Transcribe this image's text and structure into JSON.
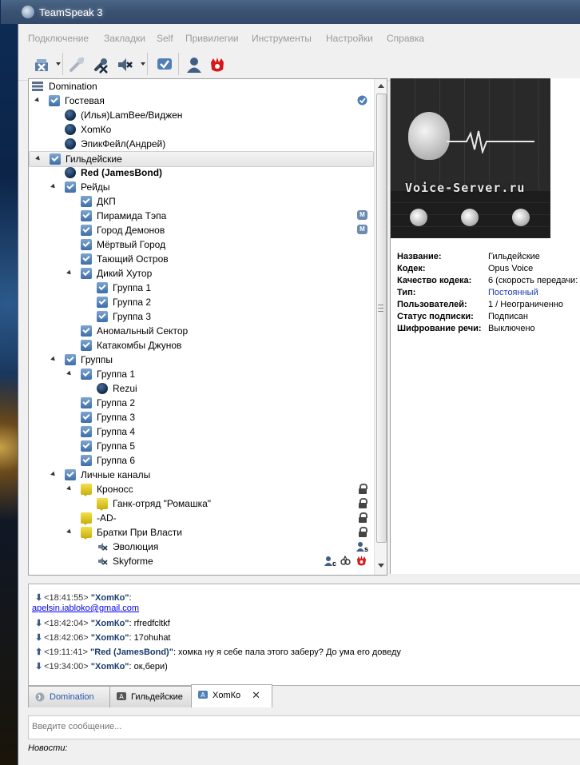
{
  "window": {
    "title": "TeamSpeak 3"
  },
  "menu": [
    "Подключение",
    "Закладки",
    "Self",
    "Привилегии",
    "Инструменты",
    "Настройки",
    "Справка"
  ],
  "toolbar": {
    "icons": [
      "disconnect-icon",
      "away-icon",
      "mute-microphone-icon",
      "mute-speakers-icon",
      "subscribe-icon",
      "contacts-icon",
      "hotkey-icon"
    ]
  },
  "tree": {
    "server": "Domination",
    "rows": [
      {
        "label": "Гостевая",
        "kind": "channel"
      },
      {
        "label": "(Илья)LamBee/Виджен",
        "kind": "client"
      },
      {
        "label": "ХomКо",
        "kind": "client"
      },
      {
        "label": "ЭпикФейл(Андрей)",
        "kind": "client"
      },
      {
        "label": "Гильдейские",
        "kind": "channel"
      },
      {
        "label": "Red (JamesBond)",
        "kind": "client"
      },
      {
        "label": "Рейды",
        "kind": "channel"
      },
      {
        "label": "ДКП",
        "kind": "channel"
      },
      {
        "label": "Пирамида Тэпа",
        "kind": "channel"
      },
      {
        "label": "Город Демонов",
        "kind": "channel"
      },
      {
        "label": "Мёртвый Город",
        "kind": "channel"
      },
      {
        "label": "Тающий Остров",
        "kind": "channel"
      },
      {
        "label": "Дикий Хутор",
        "kind": "channel"
      },
      {
        "label": "Группа 1",
        "kind": "channel"
      },
      {
        "label": "Группа 2",
        "kind": "channel"
      },
      {
        "label": "Группа 3",
        "kind": "channel"
      },
      {
        "label": "Аномальный Сектор",
        "kind": "channel"
      },
      {
        "label": "Катакомбы Джунов",
        "kind": "channel"
      },
      {
        "label": "Группы",
        "kind": "channel"
      },
      {
        "label": "Группа 1",
        "kind": "channel"
      },
      {
        "label": "Rezui",
        "kind": "client"
      },
      {
        "label": "Группа 2",
        "kind": "channel"
      },
      {
        "label": "Группа 3",
        "kind": "channel"
      },
      {
        "label": "Группа 4",
        "kind": "channel"
      },
      {
        "label": "Группа 5",
        "kind": "channel"
      },
      {
        "label": "Группа 6",
        "kind": "channel"
      },
      {
        "label": "Личные каналы",
        "kind": "channel"
      },
      {
        "label": "Кроносс",
        "kind": "channel-yellow"
      },
      {
        "label": "Ганк-отряд \"Ромашка\"",
        "kind": "channel-yellow"
      },
      {
        "label": "-AD-",
        "kind": "channel-yellow"
      },
      {
        "label": "Братки При Власти",
        "kind": "channel-yellow"
      },
      {
        "label": "Эволюция",
        "kind": "client-muted"
      },
      {
        "label": "Skyforme",
        "kind": "client-muted"
      }
    ],
    "badge_m": "M",
    "badge_s": "s",
    "badge_c": "c"
  },
  "info": {
    "banner_text": "Voice-Server.ru",
    "fields": [
      {
        "k": "Название:",
        "v": "Гильдейские"
      },
      {
        "k": "Кодек:",
        "v": "Opus Voice"
      },
      {
        "k": "Качество кодека:",
        "v": "6 (скорость передачи:"
      },
      {
        "k": "Тип:",
        "v": "Постоянный"
      },
      {
        "k": "Пользователей:",
        "v": "1 / Неограниченно"
      },
      {
        "k": "Статус подписки:",
        "v": "Подписан"
      },
      {
        "k": "Шифрование речи:",
        "v": "Выключено"
      }
    ],
    "type_color": "#1a3ab8"
  },
  "chat": {
    "messages": [
      {
        "dir": "in",
        "time": "<18:41:55>",
        "nick": "\"ХomКо\"",
        "text": ":"
      },
      {
        "link": "apelsin.iabloko@gmail.com"
      },
      {
        "dir": "in",
        "time": "<18:42:04>",
        "nick": "\"ХomКо\"",
        "text": ": rfredfcltkf"
      },
      {
        "dir": "in",
        "time": "<18:42:06>",
        "nick": "\"ХomКо\"",
        "text": ": 17ohuhat"
      },
      {
        "dir": "out",
        "time": "<19:11:41>",
        "nick": "\"Red (JamesBond)\"",
        "text": ": хомка ну я себе пала этого заберу? До ума его доведу"
      },
      {
        "dir": "in",
        "time": "<19:34:00>",
        "nick": "\"ХomКо\"",
        "text": ": ок,бери)"
      }
    ],
    "tabs": [
      {
        "label": "Domination"
      },
      {
        "label": "Гильдейские"
      },
      {
        "label": "ХomКо",
        "close": "✕"
      }
    ],
    "input_placeholder": "Введите сообщение...",
    "status": "Новости:"
  }
}
